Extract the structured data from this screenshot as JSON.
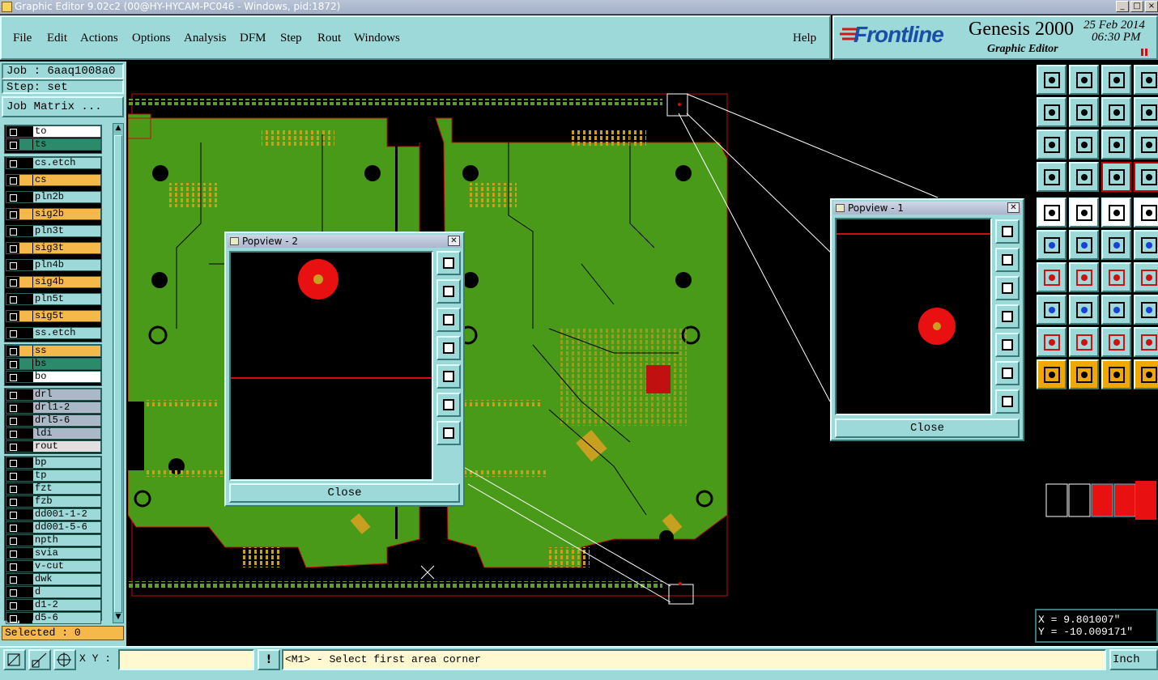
{
  "window": {
    "title": "Graphic Editor 9.02c2 (00@HY-HYCAM-PC046 - Windows, pid:1872)"
  },
  "menu": [
    "File",
    "Edit",
    "Actions",
    "Options",
    "Analysis",
    "DFM",
    "Step",
    "Rout",
    "Windows"
  ],
  "help": "Help",
  "brand": {
    "logo": "Frontline",
    "product": "Genesis 2000",
    "subtitle": "Graphic Editor",
    "date": "25 Feb 2014",
    "time": "06:30 PM"
  },
  "job": {
    "job_label": "Job : 6aaq1008a0",
    "step_label": "Step: set",
    "matrix_button": "Job Matrix ..."
  },
  "layers": [
    {
      "name": "to",
      "color": "#ffffff"
    },
    {
      "name": "ts",
      "color": "#2a8a6a"
    },
    {
      "name": "cs.etch",
      "color": "#9ed9d9"
    },
    {
      "name": "cs",
      "color": "#f5b84a"
    },
    {
      "name": "pln2b",
      "color": "#9ed9d9"
    },
    {
      "name": "sig2b",
      "color": "#f5b84a"
    },
    {
      "name": "pln3t",
      "color": "#9ed9d9"
    },
    {
      "name": "sig3t",
      "color": "#f5b84a"
    },
    {
      "name": "pln4b",
      "color": "#9ed9d9"
    },
    {
      "name": "sig4b",
      "color": "#f5b84a"
    },
    {
      "name": "pln5t",
      "color": "#9ed9d9"
    },
    {
      "name": "sig5t",
      "color": "#f5b84a"
    },
    {
      "name": "ss.etch",
      "color": "#9ed9d9"
    },
    {
      "name": "ss",
      "color": "#f5b84a"
    },
    {
      "name": "bs",
      "color": "#2a8a6a"
    },
    {
      "name": "bo",
      "color": "#ffffff"
    },
    {
      "name": "drl",
      "color": "#aab8c8"
    },
    {
      "name": "drl1-2",
      "color": "#aab8c8"
    },
    {
      "name": "drl5-6",
      "color": "#aab8c8"
    },
    {
      "name": "ldi",
      "color": "#aab8c8"
    },
    {
      "name": "rout",
      "color": "#e0e0e0"
    },
    {
      "name": "bp",
      "color": "#9ed9d9"
    },
    {
      "name": "tp",
      "color": "#9ed9d9"
    },
    {
      "name": "fzt",
      "color": "#9ed9d9"
    },
    {
      "name": "fzb",
      "color": "#9ed9d9"
    },
    {
      "name": "dd001-1-2",
      "color": "#9ed9d9"
    },
    {
      "name": "dd001-5-6",
      "color": "#9ed9d9"
    },
    {
      "name": "npth",
      "color": "#9ed9d9"
    },
    {
      "name": "svia",
      "color": "#9ed9d9"
    },
    {
      "name": "v-cut",
      "color": "#9ed9d9"
    },
    {
      "name": "dwk",
      "color": "#9ed9d9"
    },
    {
      "name": "d",
      "color": "#9ed9d9"
    },
    {
      "name": "d1-2",
      "color": "#9ed9d9"
    },
    {
      "name": "d5-6",
      "color": "#9ed9d9"
    }
  ],
  "selected": "Selected : 0",
  "popview1": {
    "title": "Popview - 1",
    "close": "Close"
  },
  "popview2": {
    "title": "Popview - 2",
    "close": "Close"
  },
  "coords": {
    "x": "X = 9.801007\"",
    "y": "Y = -10.009171\""
  },
  "status": {
    "xy_label": "X Y :",
    "xy_value": "",
    "message": "<M1> - Select first area corner",
    "unit": "Inch"
  },
  "colors": {
    "panel": "#9ed9d9",
    "board": "#4a9a1a",
    "copper": "#c8a020",
    "outline": "#d01010"
  }
}
